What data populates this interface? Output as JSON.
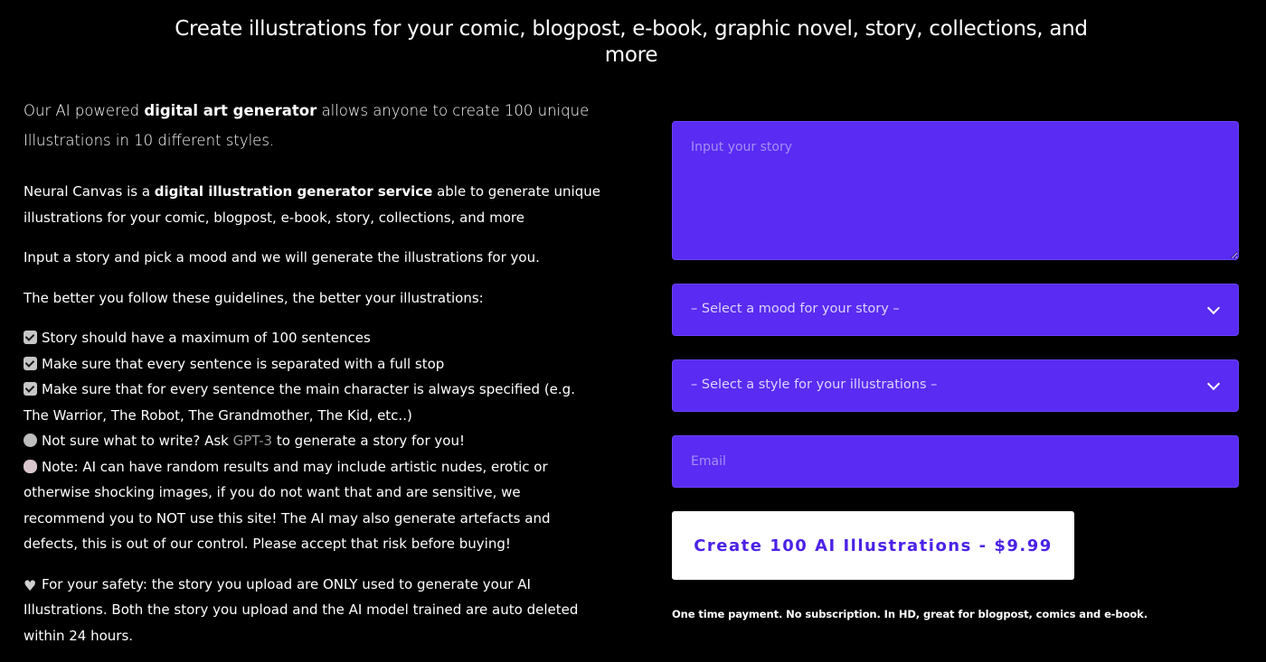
{
  "headline": "Create illustrations for your comic, blogpost, e-book, graphic novel, story, collections, and more",
  "intro": {
    "before": "Our AI powered ",
    "bold": "digital art generator",
    "after": " allows anyone to create 100 unique Illustrations in 10 different styles."
  },
  "about": {
    "before": "Neural Canvas is a ",
    "bold": "digital illustration generator service",
    "after": " able to generate unique illustrations for your comic, blogpost, e-book, story, collections, and more"
  },
  "instruction": "Input a story and pick a mood and we will generate the illustrations for you.",
  "guidelines_intro": "The better you follow these guidelines, the better your illustrations:",
  "guidelines": [
    "Story should have a maximum of 100 sentences",
    "Make sure that every sentence is separated with a full stop",
    "Make sure that for every sentence the main character is always specified (e.g. The Warrior, The Robot, The Grandmother, The Kid, etc..)"
  ],
  "gpt_tip": {
    "before": "Not sure what to write? Ask ",
    "link": "GPT-3",
    "after": " to generate a story for you!"
  },
  "warning": "Note: AI can have random results and may include artistic nudes, erotic or otherwise shocking images, if you do not want that and are sensitive, we recommend you to NOT use this site! The AI may also generate artefacts and defects, this is out of our control. Please accept that risk before buying!",
  "safety": "For your safety: the story you upload are ONLY used to generate your AI Illustrations. Both the story you upload and the AI model trained are auto deleted within 24 hours.",
  "icons": {
    "guideline": "check-box-icon",
    "tip": "thinking-face-icon",
    "warning": "brain-icon",
    "safety": "heart-icon"
  },
  "form": {
    "story_placeholder": "Input your story",
    "mood_select": "– Select a mood for your story –",
    "style_select": "– Select a style for your illustrations –",
    "email_placeholder": "Email",
    "cta_label": "Create 100 AI Illustrations - $9.99",
    "note": "One time payment. No subscription. In HD, great for blogpost, comics and e-book."
  },
  "colors": {
    "background": "#000000",
    "field": "#5a2bf2",
    "cta_text": "#4b22e6"
  }
}
